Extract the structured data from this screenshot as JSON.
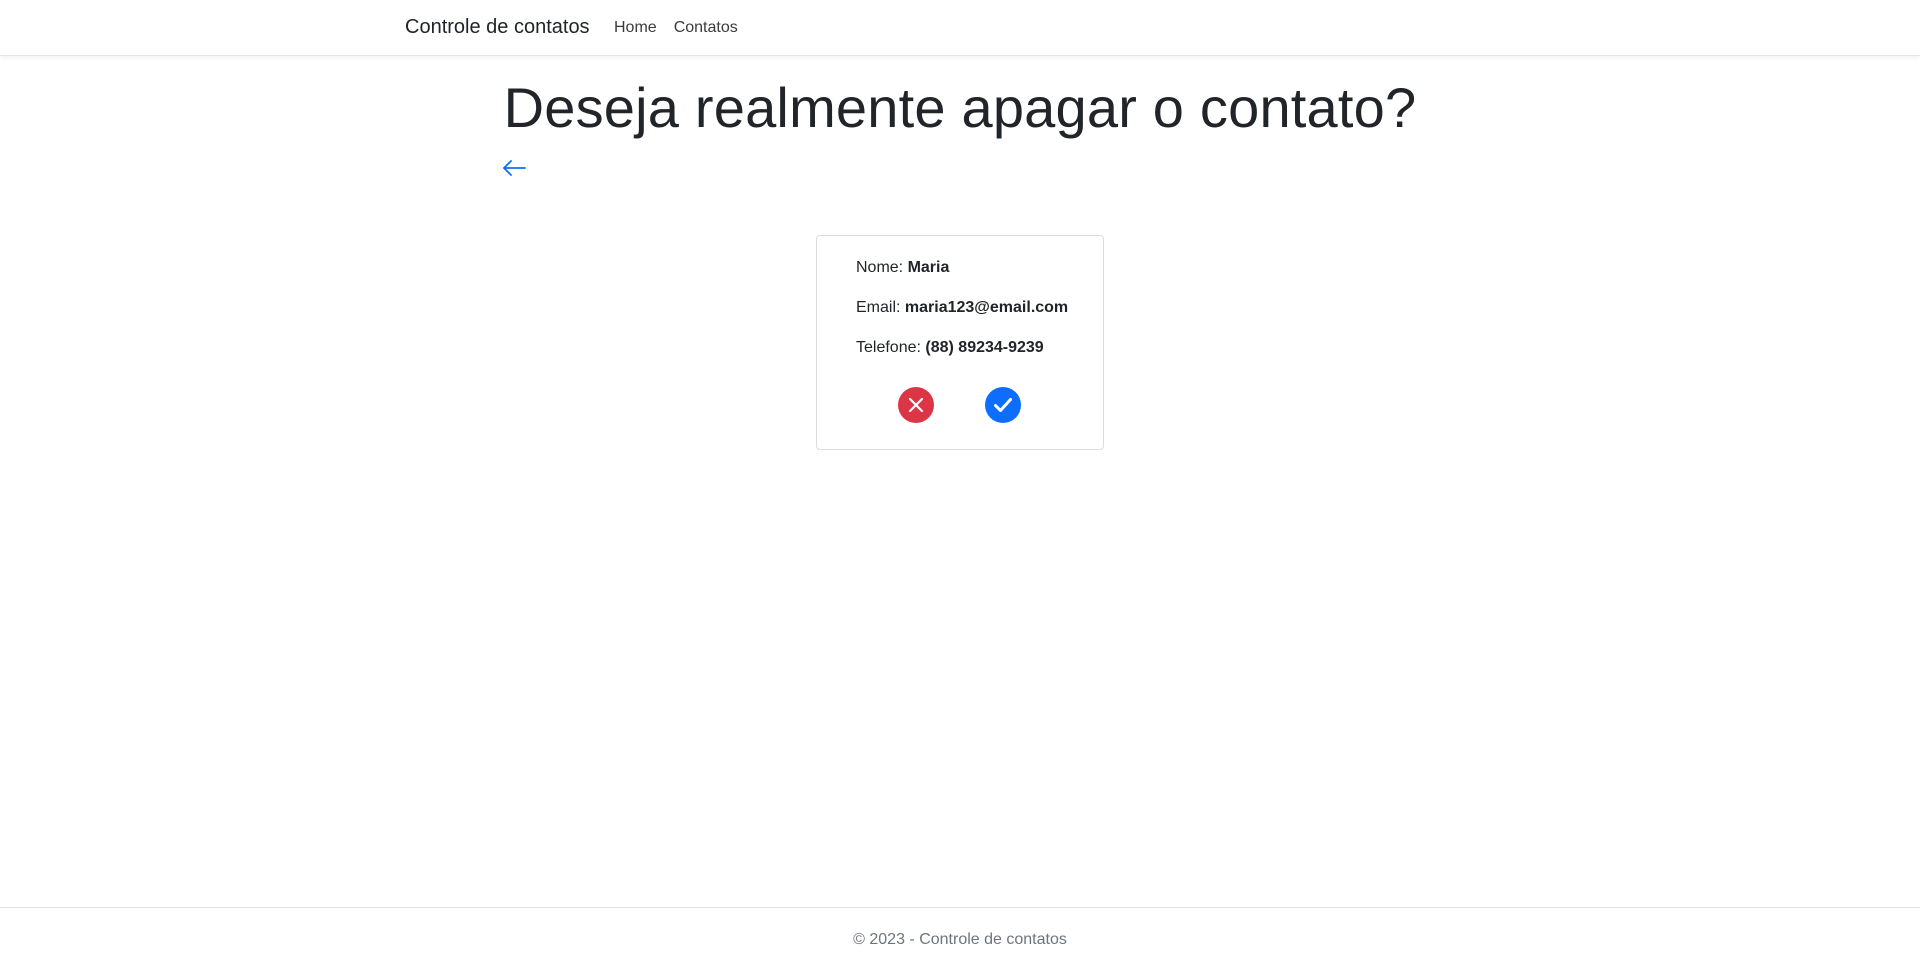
{
  "navbar": {
    "brand": "Controle de contatos",
    "links": [
      "Home",
      "Contatos"
    ]
  },
  "main": {
    "title": "Deseja realmente apagar o contato?",
    "back_icon": "arrow-left-icon"
  },
  "contact_card": {
    "name_label": "Nome:",
    "name_value": "Maria",
    "email_label": "Email:",
    "email_value": "maria123@email.com",
    "phone_label": "Telefone:",
    "phone_value": "(88) 89234-9239",
    "cancel_icon": "x-circle-icon",
    "confirm_icon": "check-circle-icon"
  },
  "footer": {
    "text": "© 2023 - Controle de contatos"
  },
  "colors": {
    "cancel": "#dc3545",
    "confirm": "#0d6efd",
    "link": "#0d6efd"
  }
}
